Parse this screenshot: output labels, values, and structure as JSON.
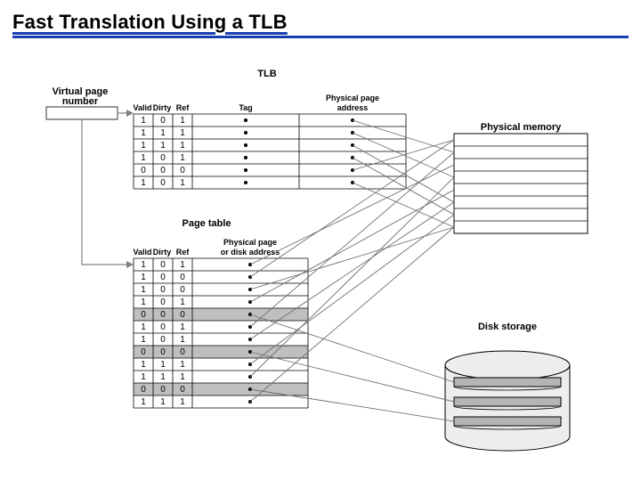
{
  "title": "Fast Translation Using a TLB",
  "labels": {
    "tlb": "TLB",
    "vpn": "Virtual page\nnumber",
    "tlb_cols": {
      "valid": "Valid",
      "dirty": "Dirty",
      "ref": "Ref",
      "tag": "Tag",
      "ppa": "Physical page\naddress"
    },
    "pt": "Page table",
    "pt_cols": {
      "valid": "Valid",
      "dirty": "Dirty",
      "ref": "Ref",
      "ppda": "Physical page\nor disk address"
    },
    "phys_mem": "Physical memory",
    "disk": "Disk storage"
  },
  "tlb_rows": [
    {
      "valid": "1",
      "dirty": "0",
      "ref": "1"
    },
    {
      "valid": "1",
      "dirty": "1",
      "ref": "1"
    },
    {
      "valid": "1",
      "dirty": "1",
      "ref": "1"
    },
    {
      "valid": "1",
      "dirty": "0",
      "ref": "1"
    },
    {
      "valid": "0",
      "dirty": "0",
      "ref": "0"
    },
    {
      "valid": "1",
      "dirty": "0",
      "ref": "1"
    }
  ],
  "pt_rows": [
    {
      "valid": "1",
      "dirty": "0",
      "ref": "1",
      "shaded": false
    },
    {
      "valid": "1",
      "dirty": "0",
      "ref": "0",
      "shaded": false
    },
    {
      "valid": "1",
      "dirty": "0",
      "ref": "0",
      "shaded": false
    },
    {
      "valid": "1",
      "dirty": "0",
      "ref": "1",
      "shaded": false
    },
    {
      "valid": "0",
      "dirty": "0",
      "ref": "0",
      "shaded": true
    },
    {
      "valid": "1",
      "dirty": "0",
      "ref": "1",
      "shaded": false
    },
    {
      "valid": "1",
      "dirty": "0",
      "ref": "1",
      "shaded": false
    },
    {
      "valid": "0",
      "dirty": "0",
      "ref": "0",
      "shaded": true
    },
    {
      "valid": "1",
      "dirty": "1",
      "ref": "1",
      "shaded": false
    },
    {
      "valid": "1",
      "dirty": "1",
      "ref": "1",
      "shaded": false
    },
    {
      "valid": "0",
      "dirty": "0",
      "ref": "0",
      "shaded": true
    },
    {
      "valid": "1",
      "dirty": "1",
      "ref": "1",
      "shaded": false
    }
  ],
  "tlb_targets": [
    1,
    3,
    5,
    6,
    0,
    7
  ],
  "pt_targets": [
    {
      "row": 0,
      "dest": "mem",
      "slot": 2
    },
    {
      "row": 1,
      "dest": "mem",
      "slot": 0
    },
    {
      "row": 2,
      "dest": "mem",
      "slot": 7
    },
    {
      "row": 3,
      "dest": "mem",
      "slot": 4
    },
    {
      "row": 4,
      "dest": "disk",
      "slot": 0
    },
    {
      "row": 5,
      "dest": "mem",
      "slot": 1
    },
    {
      "row": 6,
      "dest": "mem",
      "slot": 5
    },
    {
      "row": 7,
      "dest": "disk",
      "slot": 1
    },
    {
      "row": 8,
      "dest": "mem",
      "slot": 6
    },
    {
      "row": 9,
      "dest": "mem",
      "slot": 3
    },
    {
      "row": 10,
      "dest": "disk",
      "slot": 2
    },
    {
      "row": 11,
      "dest": "mem",
      "slot": 7
    }
  ],
  "layout": {
    "mem_slots": 8,
    "disk_slots": 3
  }
}
